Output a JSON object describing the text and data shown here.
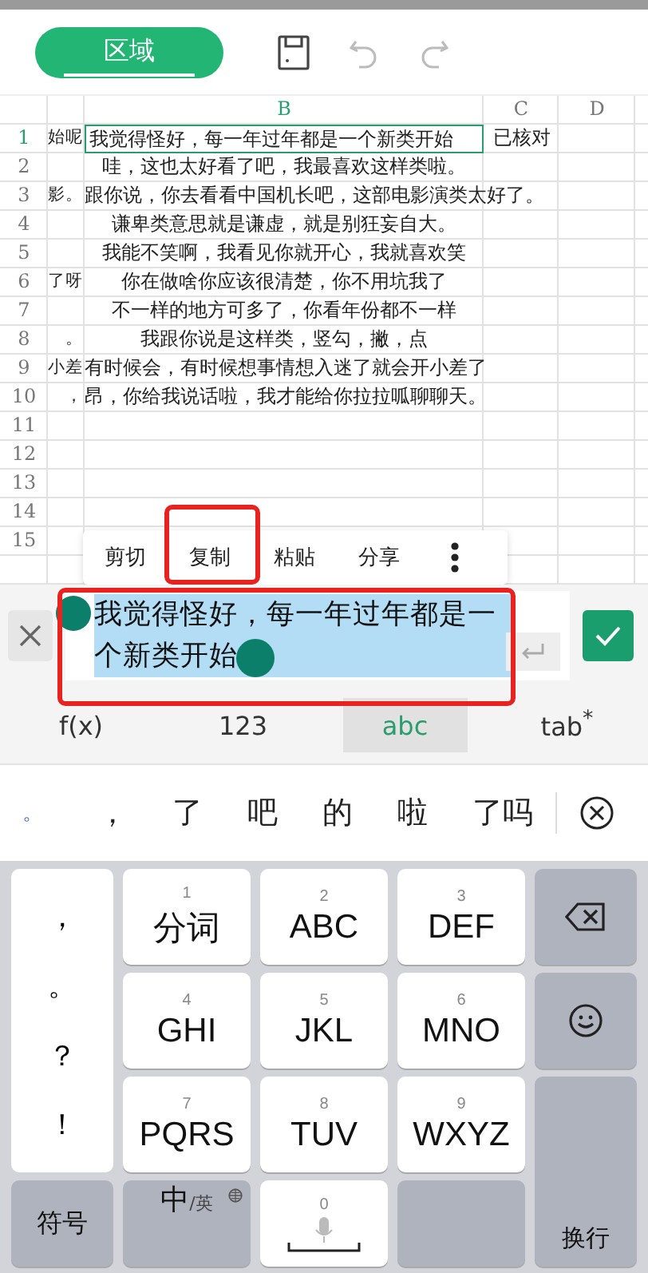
{
  "toolbar": {
    "region_button": "区域"
  },
  "sheet": {
    "columns": [
      {
        "label": "B",
        "selected": true
      },
      {
        "label": "C",
        "selected": false
      },
      {
        "label": "D",
        "selected": false
      }
    ],
    "rows": [
      {
        "number": "1",
        "selected": true,
        "a": "始呢",
        "b": "我觉得怪好，每一年过年都是一个新类开始",
        "c": "已核对"
      },
      {
        "number": "2",
        "selected": false,
        "b": "哇，这也太好看了吧，我最喜欢这样类啦。"
      },
      {
        "number": "3",
        "selected": false,
        "a": "影。",
        "b": "跟你说，你去看看中国机长吧，这部电影演类太好了。"
      },
      {
        "number": "4",
        "selected": false,
        "b": "谦卑类意思就是谦虚，就是别狂妄自大。"
      },
      {
        "number": "5",
        "selected": false,
        "b": "我能不笑啊，我看见你就开心，我就喜欢笑"
      },
      {
        "number": "6",
        "selected": false,
        "a": "了呀",
        "b": "你在做啥你应该很清楚，你不用坑我了"
      },
      {
        "number": "7",
        "selected": false,
        "b": "不一样的地方可多了，你看年份都不一样"
      },
      {
        "number": "8",
        "selected": false,
        "a": "。",
        "b": "我跟你说是这样类，竖勾，撇，点"
      },
      {
        "number": "9",
        "selected": false,
        "a": "小差",
        "b": "有时候会，有时候想事情想入迷了就会开小差了"
      },
      {
        "number": "10",
        "selected": false,
        "a": "，",
        "b": "昂，你给我说话啦，我才能给你拉拉呱聊聊天。"
      },
      {
        "number": "11",
        "selected": false
      },
      {
        "number": "12",
        "selected": false
      },
      {
        "number": "13",
        "selected": false
      },
      {
        "number": "14",
        "selected": false
      },
      {
        "number": "15",
        "selected": false
      }
    ]
  },
  "context_menu": [
    {
      "label": "剪切",
      "highlighted": false
    },
    {
      "label": "复制",
      "highlighted": true
    },
    {
      "label": "粘贴",
      "highlighted": false
    },
    {
      "label": "分享",
      "highlighted": false
    }
  ],
  "edit_bar": {
    "value": "我觉得怪好，每一年过年都是一个新类开始",
    "highlighted": true
  },
  "input_modes": [
    {
      "label": "f(x)",
      "selected": false
    },
    {
      "label": "123",
      "selected": false
    },
    {
      "label": "abc",
      "selected": true
    },
    {
      "label": "tab$^{*}$",
      "selected": false
    }
  ],
  "candidates": [
    {
      "text": "。",
      "kind": "mark"
    },
    {
      "text": "，",
      "kind": "word"
    },
    {
      "text": "了",
      "kind": "word"
    },
    {
      "text": "吧",
      "kind": "word"
    },
    {
      "text": "的",
      "kind": "word"
    },
    {
      "text": "啦",
      "kind": "word"
    },
    {
      "text": "了吗",
      "kind": "word"
    }
  ],
  "keyboard": {
    "side_keys": [
      "，",
      "。",
      "？",
      "！"
    ],
    "keys": [
      {
        "number": "1",
        "label": "分词"
      },
      {
        "number": "2",
        "label": "ABC"
      },
      {
        "number": "3",
        "label": "DEF"
      },
      {
        "number": "4",
        "label": "GHI"
      },
      {
        "number": "5",
        "label": "JKL"
      },
      {
        "number": "6",
        "label": "MNO"
      },
      {
        "number": "7",
        "label": "PQRS"
      },
      {
        "number": "8",
        "label": "TUV"
      },
      {
        "number": "9",
        "label": "WXYZ"
      }
    ],
    "return_label": "换行",
    "symbols_label": "符号",
    "language": {
      "main": "中",
      "sub": "/英"
    },
    "space_number": "0"
  }
}
